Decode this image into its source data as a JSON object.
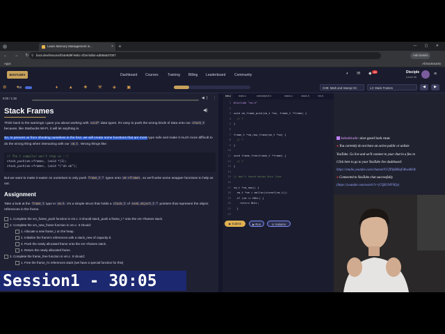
{
  "browser": {
    "tab_title": "Learn Memory Management in...",
    "url": "boot.dev/lessons/f44e9d9f-9ebc-4f16-bd54-ad59a637007",
    "profile": "Ask Gemini",
    "bookmarks_apps": "Apps",
    "all_bookmarks": "All Bookmarks"
  },
  "site": {
    "logo": "BOOT.DEV",
    "nav": [
      "Dashboard",
      "Courses",
      "Training",
      "Billing",
      "Leaderboard",
      "Community"
    ],
    "badge": "43",
    "user": "Disciple",
    "level": "Level 40"
  },
  "toolbar": {
    "level": "19",
    "chapter_select": "CH8: Mark and Sweep GC",
    "lesson_select": "L3: Stack Frames",
    "prev": "◀",
    "next": "▶"
  },
  "lesson": {
    "audio_time": "0:00 / 1:38",
    "title": "Stack Frames",
    "p1a": "Think back to the warnings I gave you about working with",
    "p1_code1": "void*",
    "p1b": "data types. It's easy to push the wrong kinds of data onto our",
    "p1_code2": "stack_t",
    "p1c": "because, like Starbucks Wi-Fi, it will let anything in.",
    "p2_highlight": "So, to prevent us from shooting ourselves in the foot, we will create some functions that are more",
    "p2b": "type safe and make it much more difficult to do the wrong thing when interacting with our",
    "p2_code": "vm_t",
    "p2c": ". Wrong things like:",
    "codeblock": [
      "// The C compiler won't stop us :'(",
      "stack_push(vm->frames, (void *)3);",
      "stack_push(vm->frames, (void *)\"oh ok\");"
    ],
    "p3a": "But we want to make it easier on ourselves to only push",
    "p3_code1": "frame_t *",
    "p3b": "types onto",
    "p3_code2": "vm->frames",
    "p3c": ", so we'll write some wrapper functions to help us out.",
    "assignment_heading": "Assignment",
    "a1a": "Take a look at the",
    "a1_code1": "frame_t",
    "a1b": "type in",
    "a1_code2": "vm.h",
    "a1c": ". It's a simple struct that holds a",
    "a1_code3": "stack_t",
    "a1d": "of",
    "a1_code4": "snek_object_t *",
    "a1e": "pointers that",
    "a2": "represent the object references in the frame.",
    "steps": [
      "1. Complete the vm_frame_push function in vm.c. It should stack_push a frame_t * onto the vm->frames stack.",
      "2. Complete the vm_new_frame function in vm.c. It should:",
      "1. Allocate a new frame_t on the heap.",
      "2. Initialize the frame's references with a stack_new of capacity 8.",
      "3. Push the newly allocated frame onto the vm->frames stack.",
      "4. Return the newly allocated frame.",
      "3. Complete the frame_free function in vm.c. It should:",
      "1. Free the frame_t's references stack (we have a special function for this)"
    ]
  },
  "editor": {
    "tabs": [
      "vm.c",
      "main.c",
      "snekobject.h",
      "stack.c",
      "stack.h",
      "vm.h"
    ],
    "lines": [
      "#include \"vm.h\"",
      "",
      "void vm_frame_push(vm_t *vm, frame_t *frame) {",
      "  // ?",
      "}",
      "",
      "frame_t *vm_new_frame(vm_t *vm) {",
      "  // ?",
      "}",
      "",
      "void frame_free(frame_t *frame) {",
      "  // ?",
      "}",
      "",
      "// don't touch below this line",
      "",
      "vm_t *vm_new() {",
      "  vm_t *vm = malloc(sizeof(vm_t));",
      "  if (vm == NULL) {",
      "    return NULL;",
      "  }",
      "",
      "  vm->frames = stack_new(8);",
      "  vm->objects = stack_new(8);",
      "  return vm;"
    ],
    "submit": "Submit",
    "run": "Run",
    "solution": "Solution"
  },
  "chat": {
    "user": "kebathiude",
    "user_msg": "nice good luck man",
    "sys1": "You currently do not have an active public or unliste",
    "sys2": "YouTube. Go live and we'll connect to your chat in a few m",
    "sys3": "Click here to go to your YouTube live dashboard:",
    "link1": "https://studio.youtube.com/channel/UCfINpBHqFdhwdkOk",
    "sys4": "Connected to YouTube chat successfully.",
    "link2": "(https://youtube.com/watch?v=jCQK1WF0Qx)"
  },
  "overlay": {
    "timer": "Session1 - 30:05"
  },
  "colors": {
    "accent": "#c8a25a",
    "highlight": "#2857c9",
    "submit": "#e0b050",
    "run": "#7c8cff",
    "chat_user": "#e0a0ff",
    "chat_link": "#9aa8ff",
    "timer_bg": "#1c2870"
  }
}
